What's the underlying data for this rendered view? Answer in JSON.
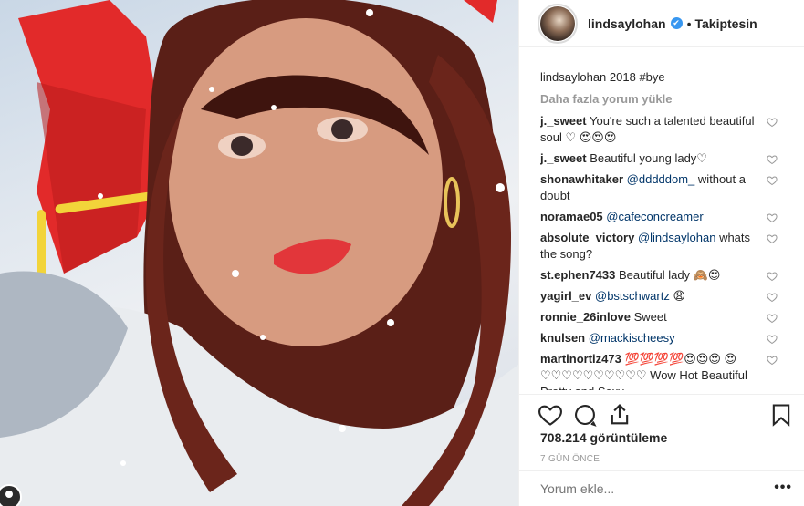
{
  "header": {
    "username": "lindsaylohan",
    "verified_glyph": "✔",
    "separator": "•",
    "follow_state": "Takiptesin"
  },
  "caption": {
    "username": "lindsaylohan",
    "text": "2018",
    "hashtag": "#bye"
  },
  "load_more": "Daha fazla yorum yükle",
  "comments": [
    {
      "username": "j._sweet",
      "text": "You're such a talented beautiful soul ♡ 😍😍😍"
    },
    {
      "username": "j._sweet",
      "text": "Beautiful young lady♡"
    },
    {
      "username": "shonawhitaker",
      "mention": "@dddddom_",
      "text": "without a doubt"
    },
    {
      "username": "noramae05",
      "mention": "@cafeconcreamer",
      "text": ""
    },
    {
      "username": "absolute_victory",
      "mention": "@lindsaylohan",
      "text": "whats the song?"
    },
    {
      "username": "st.ephen7433",
      "text": "Beautiful lady 🙈😍"
    },
    {
      "username": "yagirl_ev",
      "mention": "@bstschwartz",
      "text": "😩"
    },
    {
      "username": "ronnie_26inlove",
      "text": "Sweet"
    },
    {
      "username": "knulsen",
      "mention": "@mackischeesy",
      "text": ""
    },
    {
      "username": "martinortiz473",
      "text": "💯💯💯💯😍😍😍 😍♡♡♡♡♡♡♡♡♡♡ Wow Hot Beautiful Pretty and Sexy"
    }
  ],
  "actions": {
    "like": "heart-icon",
    "comment": "comment-icon",
    "share": "share-icon",
    "save": "bookmark-icon"
  },
  "views": "708.214 görüntüleme",
  "date": "7 GÜN ÖNCE",
  "add_comment": {
    "placeholder": "Yorum ekle...",
    "more": "•••"
  }
}
